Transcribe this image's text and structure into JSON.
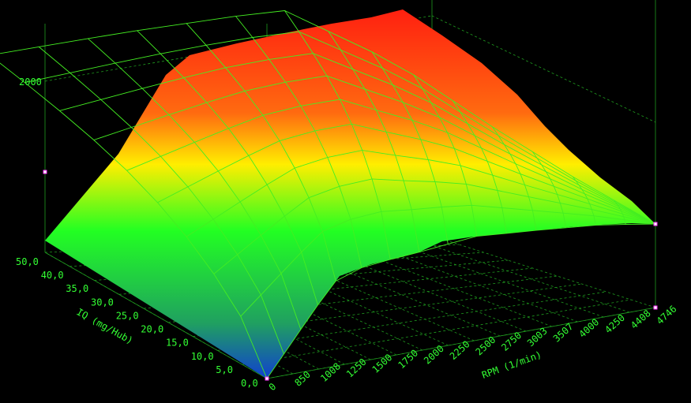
{
  "chart_data": {
    "type": "surface",
    "x_axis": {
      "label": "RPM (1/min)",
      "ticks": [
        "0",
        "850",
        "1008",
        "1250",
        "1500",
        "1750",
        "2000",
        "2250",
        "2500",
        "2750",
        "3003",
        "3507",
        "4000",
        "4250",
        "4408",
        "4746"
      ]
    },
    "y_axis": {
      "label": "IQ (mg/Hub)",
      "ticks": [
        "0,0",
        "5,0",
        "10,0",
        "15,0",
        "20,0",
        "25,0",
        "30,0",
        "35,0",
        "40,0",
        "50,0"
      ]
    },
    "z_axis": {
      "ticks": [
        "2000"
      ]
    },
    "colors": {
      "low": "#1040d0",
      "mid": "#22ff22",
      "high_mid": "#ffee00",
      "high": "#ff2010",
      "text": "#33ff33"
    }
  }
}
